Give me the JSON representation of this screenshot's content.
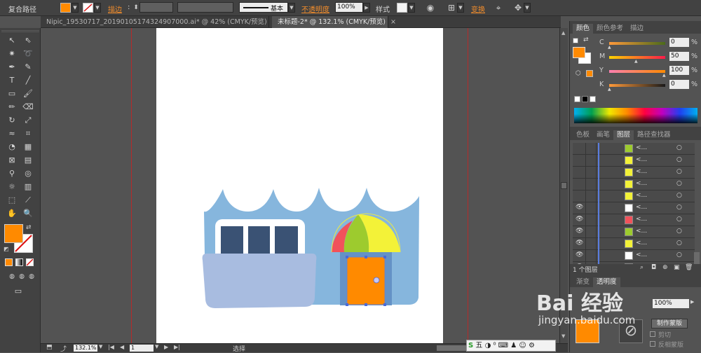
{
  "control_bar": {
    "selection_label": "复合路径",
    "stroke_label": "描边",
    "stroke_style_label": "基本",
    "opacity_label": "不透明度",
    "opacity_value": "100%",
    "style_label": "样式",
    "transform_label": "变换"
  },
  "tabs": [
    {
      "label": "Nipic_19530717_20190105174324907000.ai* @ 42% (CMYK/预览)"
    },
    {
      "label": "未标题-2* @ 132.1% (CMYK/预览)"
    }
  ],
  "colors": {
    "fill": "#ff8a00",
    "ui_accent": "#f08c2c",
    "bleed": "#b52b2b"
  },
  "color_panel": {
    "tabs": [
      "颜色",
      "颜色参考",
      "描边"
    ],
    "channels": [
      {
        "name": "C",
        "value": "0"
      },
      {
        "name": "M",
        "value": "50"
      },
      {
        "name": "Y",
        "value": "100"
      },
      {
        "name": "K",
        "value": "0"
      }
    ]
  },
  "layers_panel": {
    "tabs": [
      "色板",
      "画笔",
      "图层",
      "路径查找器"
    ],
    "row_label": "<...",
    "footer": "1 个图层"
  },
  "lower_panel": {
    "tabs": [
      "渐变",
      "透明度"
    ],
    "opacity_value": "100%",
    "make_mask_label": "制作蒙版",
    "clip_label": "剪切",
    "invert_label": "反相蒙版"
  },
  "status": {
    "zoom": "132.1%",
    "page": "1",
    "tool": "选择"
  },
  "watermark": {
    "brand": "Bai 经验",
    "url": "jingyan.baidu.com"
  }
}
